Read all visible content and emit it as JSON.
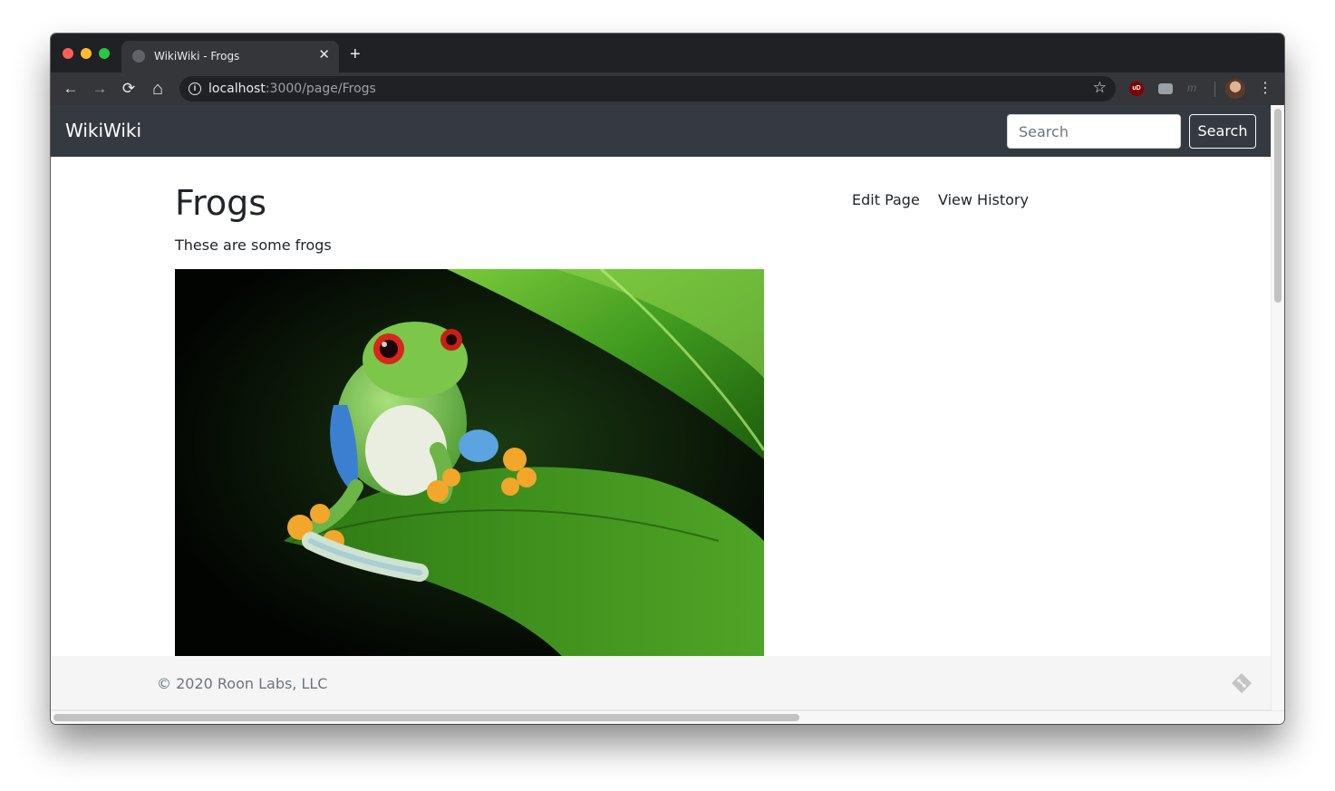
{
  "browser": {
    "tab_title": "WikiWiki - Frogs",
    "tab_close": "✕",
    "new_tab": "+",
    "url_host": "localhost",
    "url_path": ":3000/page/Frogs",
    "back": "←",
    "forward": "→",
    "reload": "⟳",
    "home": "⌂",
    "bookmark_star": "☆",
    "ublock_label": "uD",
    "ext_m_label": "m",
    "menu": "⋮"
  },
  "navbar": {
    "brand": "WikiWiki",
    "search_placeholder": "Search",
    "search_button": "Search"
  },
  "page": {
    "title": "Frogs",
    "description": "These are some frogs",
    "edit_link": "Edit Page",
    "history_link": "View History",
    "image_subject": "red-eyed tree frog on a green leaf"
  },
  "footer": {
    "copyright": "© 2020 Roon Labs, LLC",
    "icon": "git-icon"
  },
  "colors": {
    "navbar_bg": "#343a40",
    "footer_bg": "#f5f5f5",
    "text": "#212529",
    "muted": "#6c757d"
  }
}
